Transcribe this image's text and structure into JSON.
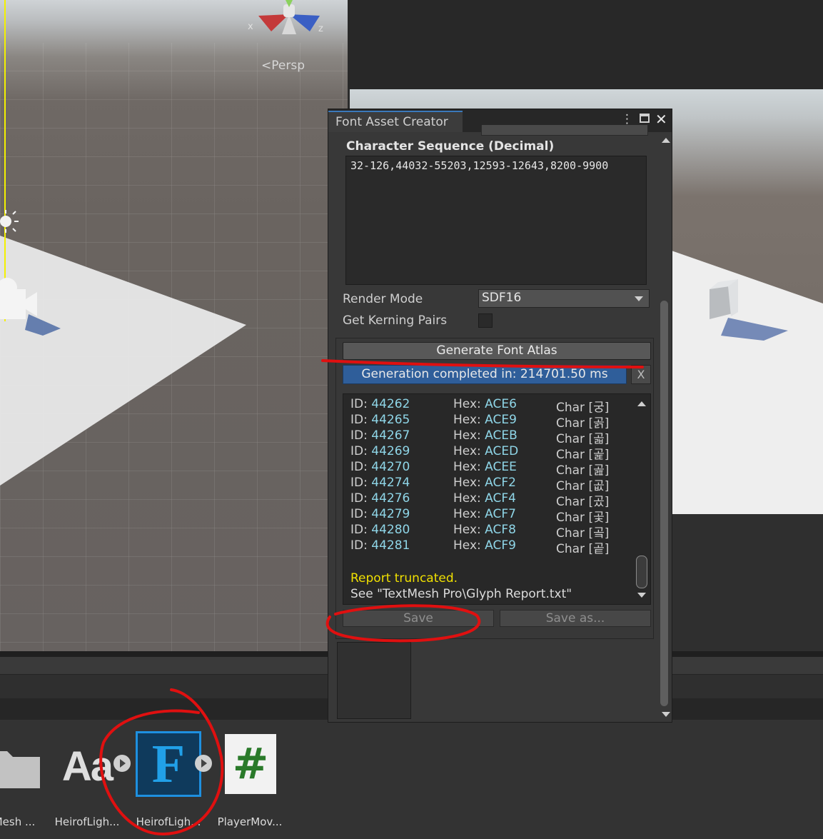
{
  "scene": {
    "axis_x": "x",
    "axis_z": "z",
    "persp_label": "Persp"
  },
  "window": {
    "title": "Font Asset Creator",
    "menu_icon": "kebab-menu-icon",
    "maximize_icon": "maximize-icon",
    "close_icon": "close-icon"
  },
  "fields": {
    "char_seq_label": "Character Sequence (Decimal)",
    "char_seq_value": "32-126,44032-55203,12593-12643,8200-9900",
    "render_mode_label": "Render Mode",
    "render_mode_value": "SDF16",
    "kerning_label": "Get Kerning Pairs"
  },
  "actions": {
    "generate_label": "Generate Font Atlas",
    "progress_text": "Generation completed in: 214701.50 ms",
    "progress_cancel": "X",
    "save_label": "Save",
    "save_as_label": "Save as..."
  },
  "report": {
    "id_prefix": "ID:",
    "hex_prefix": "Hex:",
    "char_prefix": "Char",
    "rows": [
      {
        "id": "44262",
        "hex": "ACE6",
        "char": "궁"
      },
      {
        "id": "44265",
        "hex": "ACE9",
        "char": "곩"
      },
      {
        "id": "44267",
        "hex": "ACEB",
        "char": "곫"
      },
      {
        "id": "44269",
        "hex": "ACED",
        "char": "곭"
      },
      {
        "id": "44270",
        "hex": "ACEE",
        "char": "곮"
      },
      {
        "id": "44274",
        "hex": "ACF2",
        "char": "곲"
      },
      {
        "id": "44276",
        "hex": "ACF4",
        "char": "곴"
      },
      {
        "id": "44279",
        "hex": "ACF7",
        "char": "곷"
      },
      {
        "id": "44280",
        "hex": "ACF8",
        "char": "곸"
      },
      {
        "id": "44281",
        "hex": "ACF9",
        "char": "곹"
      }
    ],
    "truncated": "Report truncated.",
    "see": "See \"TextMesh Pro\\Glyph Report.txt\""
  },
  "assets": [
    {
      "label": "Mesh ...",
      "icon": "folder-icon"
    },
    {
      "label": "HeirofLigh...",
      "icon": "font-aa-icon",
      "glyph": "Aa"
    },
    {
      "label": "HeirofLigh...",
      "icon": "font-asset-f-icon",
      "glyph": "F"
    },
    {
      "label": "PlayerMov...",
      "icon": "csharp-script-icon",
      "glyph": "#"
    }
  ],
  "colors": {
    "accent_blue": "#2f5e9a",
    "id_value": "#8fd6e8",
    "warning_yellow": "#f0e000",
    "annotation_red": "#e01010"
  }
}
